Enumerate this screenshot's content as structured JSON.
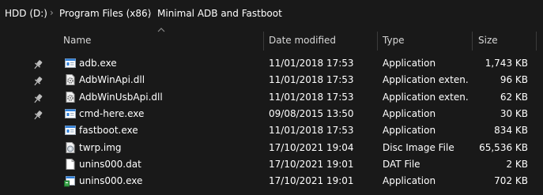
{
  "address": {
    "segments": [
      {
        "label": "HDD (D:)"
      },
      {
        "label": "Program Files (x86)"
      },
      {
        "label": "Minimal ADB and Fastboot"
      }
    ],
    "separator": "›"
  },
  "columns": {
    "name": "Name",
    "date": "Date modified",
    "type": "Type",
    "size": "Size"
  },
  "files": [
    {
      "name": "adb.exe",
      "date": "11/01/2018 17:53",
      "type": "Application",
      "size": "1,743 KB",
      "icon": "exe-window-icon",
      "pinned": true
    },
    {
      "name": "AdbWinApi.dll",
      "date": "11/01/2018 17:53",
      "type": "Application exten...",
      "size": "96 KB",
      "icon": "dll-gear-icon",
      "pinned": true
    },
    {
      "name": "AdbWinUsbApi.dll",
      "date": "11/01/2018 17:53",
      "type": "Application exten...",
      "size": "62 KB",
      "icon": "dll-gear-icon",
      "pinned": true
    },
    {
      "name": "cmd-here.exe",
      "date": "09/08/2015 13:50",
      "type": "Application",
      "size": "30 KB",
      "icon": "exe-window-icon",
      "pinned": true
    },
    {
      "name": "fastboot.exe",
      "date": "11/01/2018 17:53",
      "type": "Application",
      "size": "834 KB",
      "icon": "exe-window-icon",
      "pinned": false
    },
    {
      "name": "twrp.img",
      "date": "17/10/2021 19:04",
      "type": "Disc Image File",
      "size": "65,536 KB",
      "icon": "disc-image-icon",
      "pinned": false
    },
    {
      "name": "unins000.dat",
      "date": "17/10/2021 19:01",
      "type": "DAT File",
      "size": "2 KB",
      "icon": "blank-file-icon",
      "pinned": false
    },
    {
      "name": "unins000.exe",
      "date": "17/10/2021 19:01",
      "type": "Application",
      "size": "702 KB",
      "icon": "installer-icon",
      "pinned": false
    }
  ],
  "colors": {
    "background": "#191919",
    "text": "#ffffff",
    "header_text": "#d6d6d6",
    "separator": "#3b3b3b",
    "exe_accent": "#2e7fd9"
  }
}
